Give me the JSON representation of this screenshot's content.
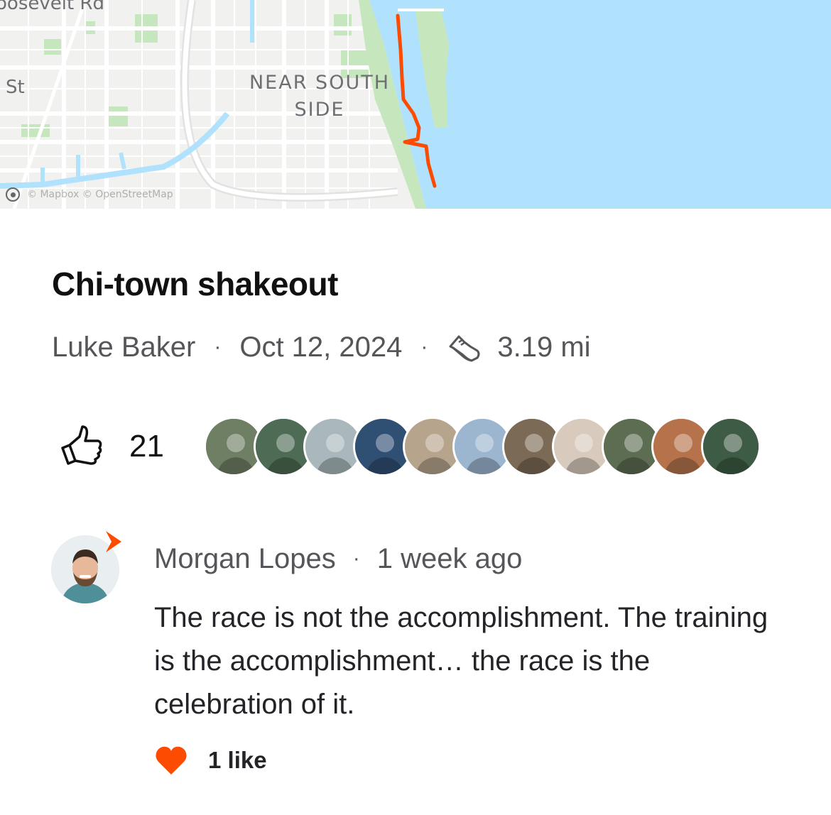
{
  "map": {
    "labels": {
      "roosevelt": "oosevelt Rd",
      "st": "St",
      "neighborhood_line1": "NEAR SOUTH",
      "neighborhood_line2": "SIDE"
    },
    "attribution": "© Mapbox © OpenStreetMap",
    "colors": {
      "water": "#b1e2fd",
      "park": "#c6e7bd",
      "route": "#fc4c02",
      "land": "#f1f1ef"
    }
  },
  "activity": {
    "title": "Chi-town shakeout",
    "athlete": "Luke Baker",
    "date": "Oct 12, 2024",
    "sport_icon": "running-shoe-icon",
    "distance": "3.19 mi"
  },
  "kudos": {
    "icon": "thumbs-up-icon",
    "count": "21",
    "avatars": [
      {
        "bg": "#6f7f64"
      },
      {
        "bg": "#4d6b55"
      },
      {
        "bg": "#aab8bd"
      },
      {
        "bg": "#2f4f73"
      },
      {
        "bg": "#b7a48c"
      },
      {
        "bg": "#9cb6cf"
      },
      {
        "bg": "#7b6a55"
      },
      {
        "bg": "#d8cbbd"
      },
      {
        "bg": "#5c6d52"
      },
      {
        "bg": "#b6734b"
      },
      {
        "bg": "#3e5b45"
      }
    ]
  },
  "comment": {
    "author": "Morgan Lopes",
    "time": "1 week ago",
    "text": "The race is not the accomplishment. The training is the accomplishment… the race is the celebration of it.",
    "likes_label": "1 like",
    "badge_color": "#fc4c02",
    "heart_color": "#fc4c02"
  }
}
